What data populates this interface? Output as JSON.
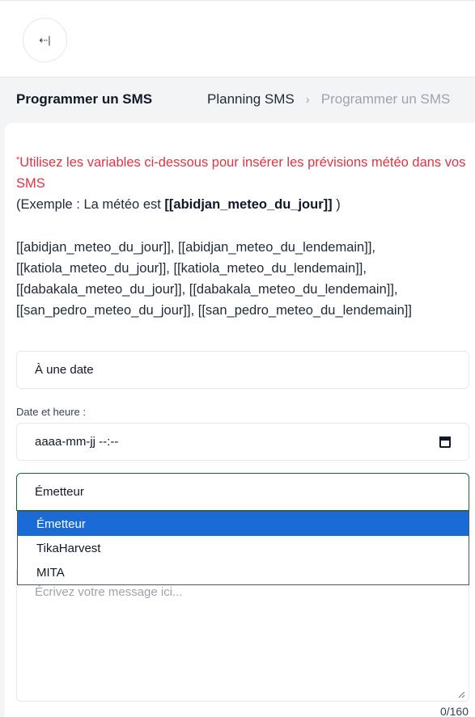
{
  "header": {
    "back_icon": "⇠|",
    "title": "Programmer un SMS",
    "breadcrumb": [
      "Planning SMS",
      "Programmer un SMS"
    ],
    "breadcrumb_separator": "›"
  },
  "note": {
    "asterisk": "*",
    "text": "Utilisez les variables ci-dessous pour insérer les prévisions météo dans vos SMS",
    "example_prefix": "(Exemple : La météo est ",
    "example_var": "[[abidjan_meteo_du_jour]]",
    "example_suffix": " )"
  },
  "variables": [
    "[[abidjan_meteo_du_jour]], [[abidjan_meteo_du_lendemain]],",
    "[[katiola_meteo_du_jour]], [[katiola_meteo_du_lendemain]],",
    "[[dabakala_meteo_du_jour]], [[dabakala_meteo_du_lendemain]],",
    "[[san_pedro_meteo_du_jour]], [[san_pedro_meteo_du_lendemain]]"
  ],
  "form": {
    "schedule_value": "À une date",
    "date_label": "Date et heure :",
    "date_placeholder": "aaaa-mm-jj --:--",
    "sender_value": "Émetteur",
    "sender_options": [
      "Émetteur",
      "TikaHarvest",
      "MITA"
    ],
    "message_placeholder": "Écrivez votre message ici...",
    "counter": "0/160"
  },
  "colors": {
    "accent_red": "#dc3545",
    "selected_option": "#1a6bd6",
    "focus_border": "#166534"
  }
}
